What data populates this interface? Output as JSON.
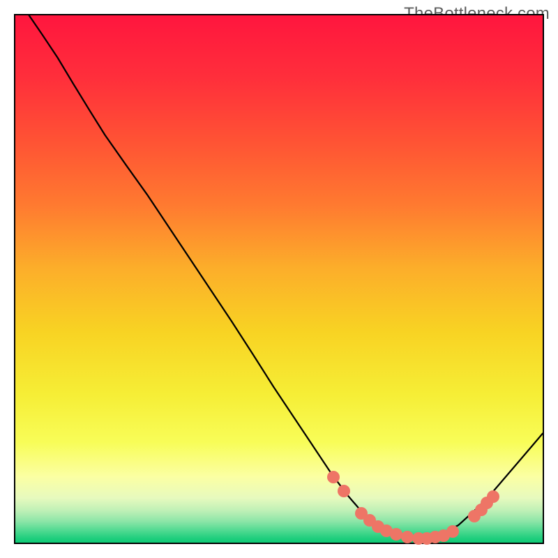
{
  "watermark": "TheBottleneck.com",
  "chart_data": {
    "type": "line",
    "title": "",
    "xlabel": "",
    "ylabel": "",
    "xlim": [
      0,
      100
    ],
    "ylim": [
      0,
      100
    ],
    "grid": false,
    "curve_points": [
      {
        "x": 2.6,
        "y": 100.0
      },
      {
        "x": 5.0,
        "y": 96.5
      },
      {
        "x": 8.0,
        "y": 92.0
      },
      {
        "x": 11.0,
        "y": 87.0
      },
      {
        "x": 14.0,
        "y": 82.1
      },
      {
        "x": 17.0,
        "y": 77.3
      },
      {
        "x": 21.0,
        "y": 71.6
      },
      {
        "x": 25.0,
        "y": 66.0
      },
      {
        "x": 29.0,
        "y": 60.0
      },
      {
        "x": 33.0,
        "y": 54.0
      },
      {
        "x": 37.0,
        "y": 48.0
      },
      {
        "x": 41.0,
        "y": 42.0
      },
      {
        "x": 45.0,
        "y": 35.8
      },
      {
        "x": 49.0,
        "y": 29.5
      },
      {
        "x": 53.0,
        "y": 23.5
      },
      {
        "x": 57.0,
        "y": 17.5
      },
      {
        "x": 60.0,
        "y": 13.0
      },
      {
        "x": 63.0,
        "y": 9.0
      },
      {
        "x": 66.0,
        "y": 5.5
      },
      {
        "x": 69.0,
        "y": 3.2
      },
      {
        "x": 72.0,
        "y": 1.8
      },
      {
        "x": 75.0,
        "y": 1.2
      },
      {
        "x": 78.0,
        "y": 1.2
      },
      {
        "x": 81.0,
        "y": 1.8
      },
      {
        "x": 84.0,
        "y": 3.3
      },
      {
        "x": 87.0,
        "y": 6.0
      },
      {
        "x": 90.0,
        "y": 9.0
      },
      {
        "x": 93.0,
        "y": 12.5
      },
      {
        "x": 96.0,
        "y": 16.0
      },
      {
        "x": 100.0,
        "y": 20.7
      }
    ],
    "marker_points": [
      {
        "x": 60.0,
        "y": 12.9
      },
      {
        "x": 62.0,
        "y": 10.3
      },
      {
        "x": 65.3,
        "y": 6.1
      },
      {
        "x": 66.8,
        "y": 4.7
      },
      {
        "x": 68.4,
        "y": 3.6
      },
      {
        "x": 70.0,
        "y": 2.8
      },
      {
        "x": 71.8,
        "y": 2.1
      },
      {
        "x": 74.0,
        "y": 1.6
      },
      {
        "x": 76.0,
        "y": 1.32
      },
      {
        "x": 77.6,
        "y": 1.32
      },
      {
        "x": 79.2,
        "y": 1.58
      },
      {
        "x": 80.8,
        "y": 1.84
      },
      {
        "x": 82.5,
        "y": 2.6
      },
      {
        "x": 86.6,
        "y": 5.5
      },
      {
        "x": 87.9,
        "y": 6.7
      },
      {
        "x": 89.0,
        "y": 8.0
      },
      {
        "x": 90.1,
        "y": 9.2
      }
    ],
    "gradient_stops": [
      {
        "offset": 0.0,
        "color": "#ff163e"
      },
      {
        "offset": 0.12,
        "color": "#ff2f3b"
      },
      {
        "offset": 0.24,
        "color": "#ff5334"
      },
      {
        "offset": 0.36,
        "color": "#ff7a30"
      },
      {
        "offset": 0.48,
        "color": "#fcae2a"
      },
      {
        "offset": 0.6,
        "color": "#f8d323"
      },
      {
        "offset": 0.72,
        "color": "#f6ee36"
      },
      {
        "offset": 0.81,
        "color": "#f8fd58"
      },
      {
        "offset": 0.875,
        "color": "#fbffa3"
      },
      {
        "offset": 0.915,
        "color": "#e7fabe"
      },
      {
        "offset": 0.94,
        "color": "#bdf0b6"
      },
      {
        "offset": 0.96,
        "color": "#8be5a7"
      },
      {
        "offset": 0.978,
        "color": "#4dd990"
      },
      {
        "offset": 0.992,
        "color": "#1fce7d"
      },
      {
        "offset": 1.0,
        "color": "#0ecb77"
      }
    ]
  }
}
